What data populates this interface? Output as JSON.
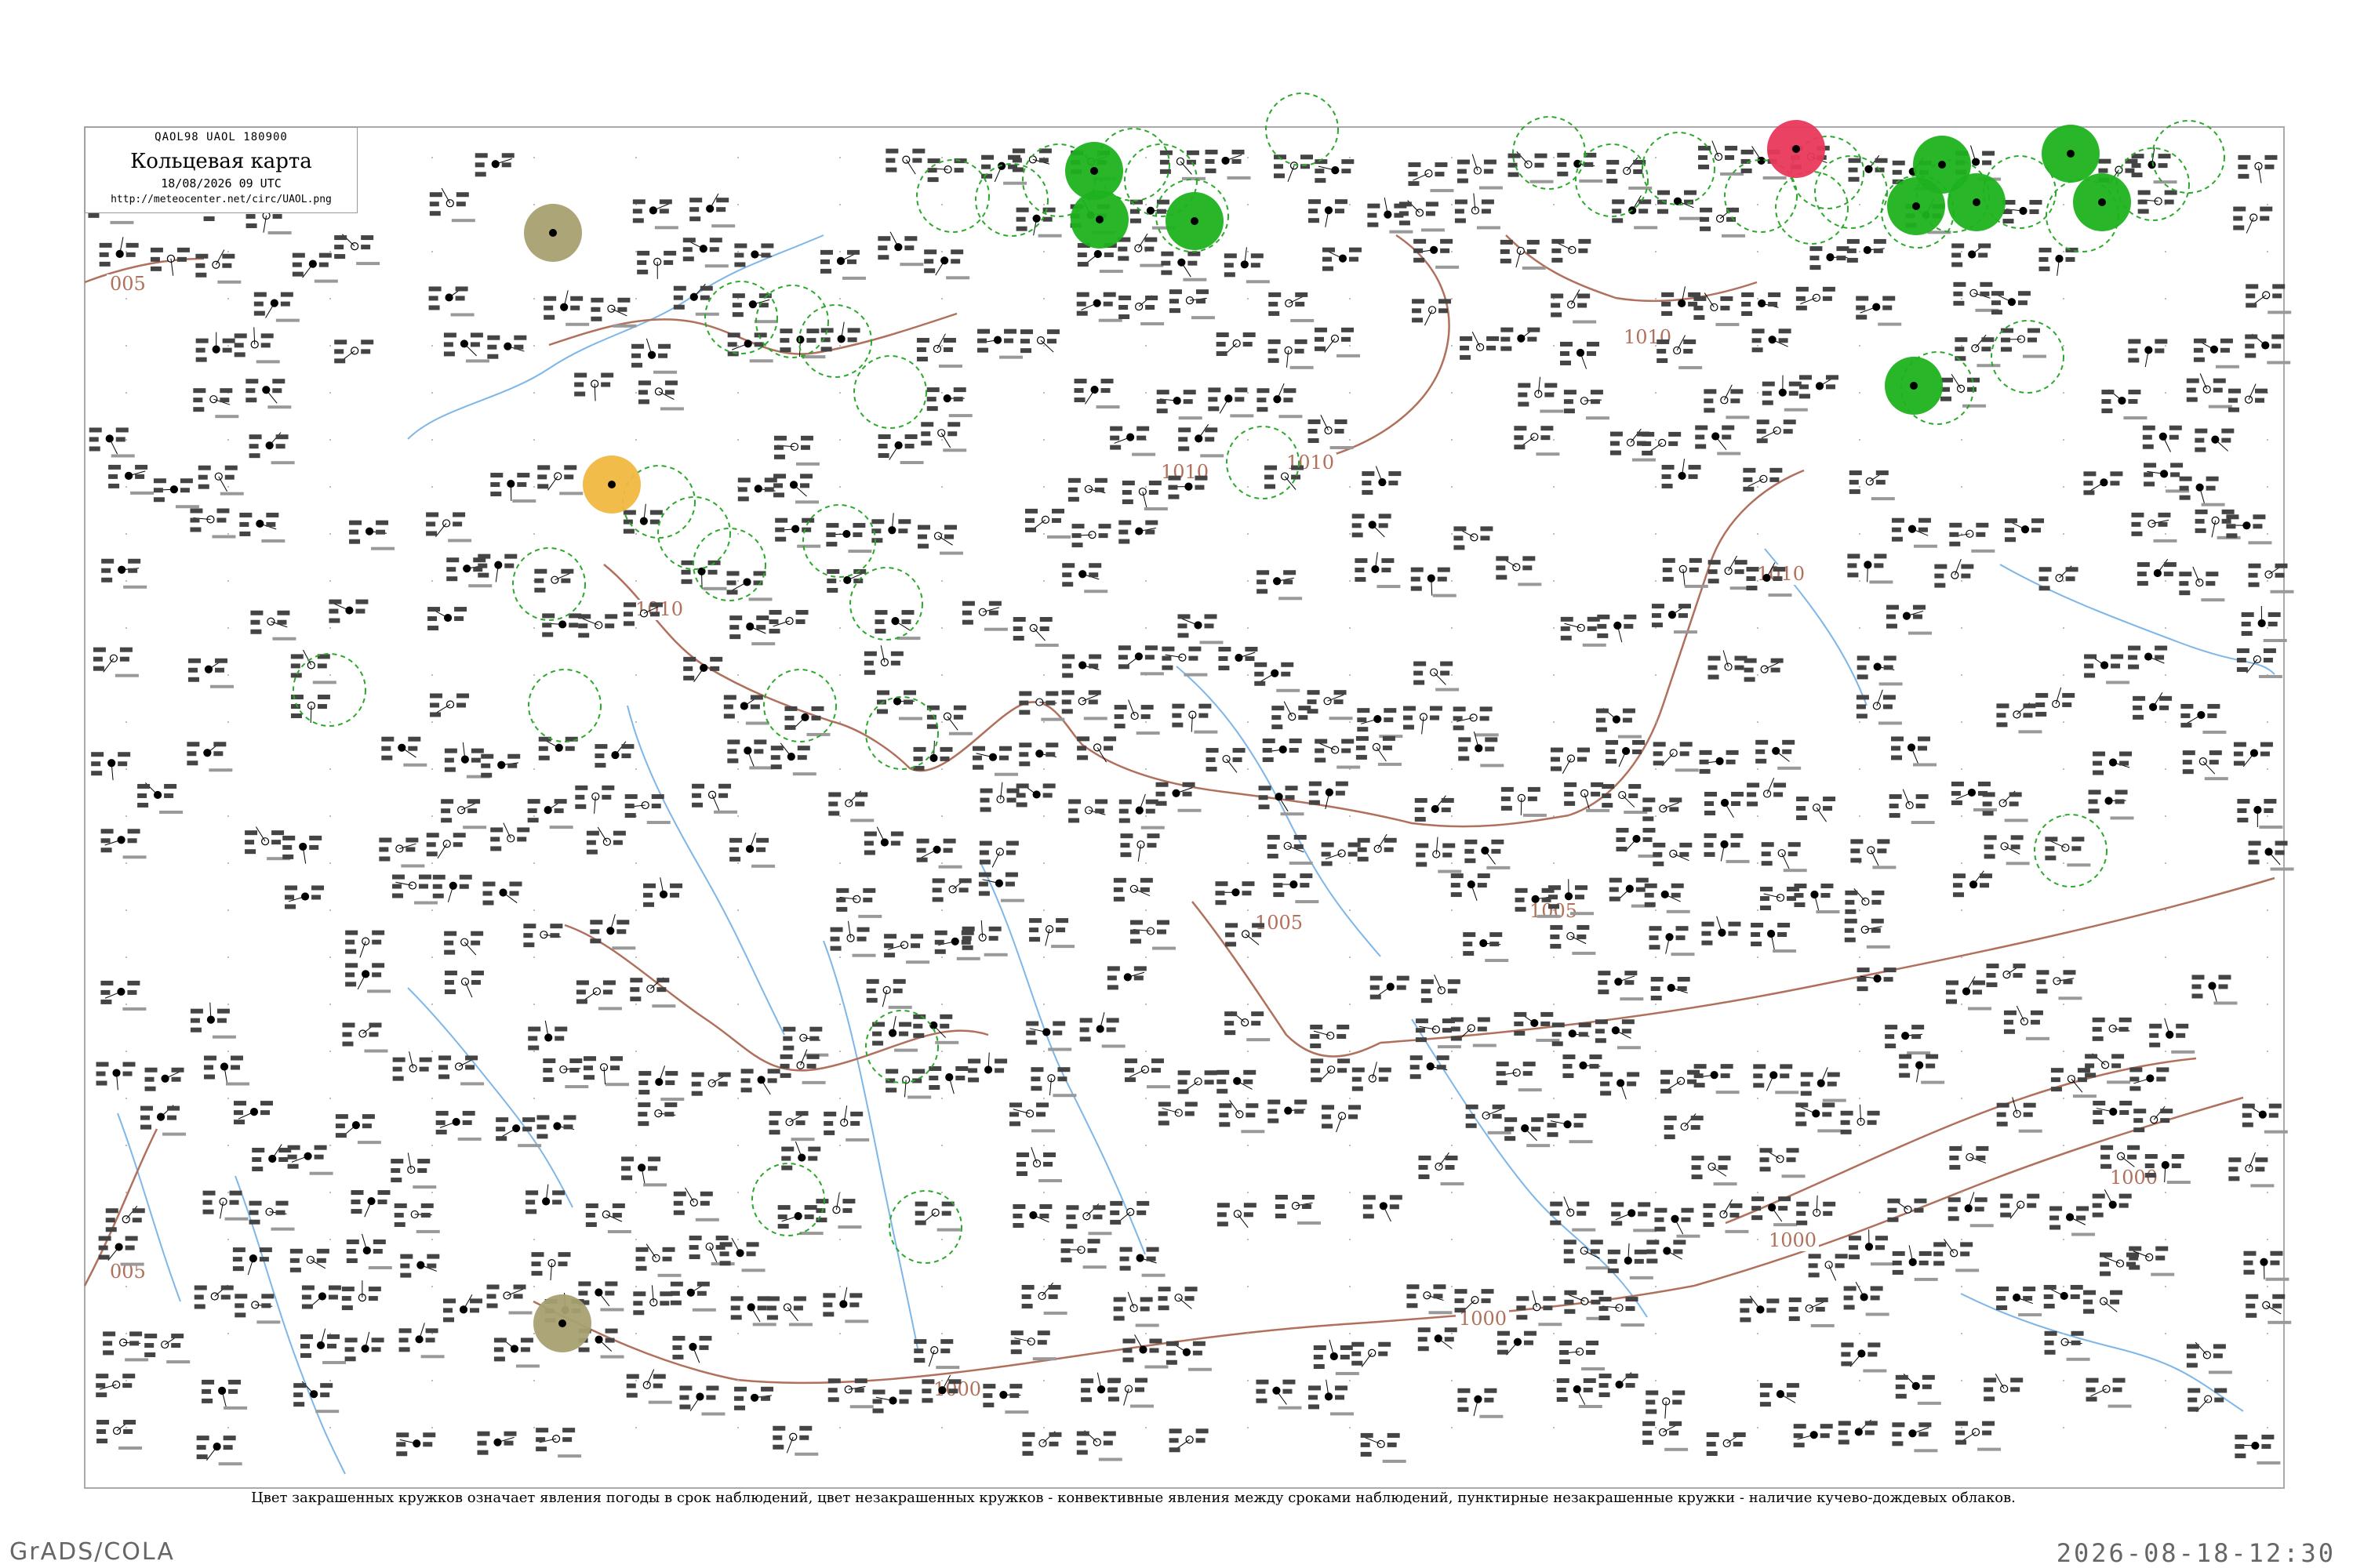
{
  "header": {
    "code_line": "QAOL98  UAOL  180900",
    "title": "Кольцевая карта",
    "datetime": "18/08/2026 09 UTC",
    "url": "http://meteocenter.net/circ/UAOL.png"
  },
  "caption": "Цвет закрашенных кружков означает явления погоды в срок наблюдений, цвет незакрашенных кружков - конвективные явления между сроками наблюдений, пунктирные незакрашенные кружки - наличие кучево-дождевых облаков.",
  "footer": {
    "left": "GrADS/COLA",
    "right": "2026-08-18-12:30"
  },
  "isobar_labels": [
    "1010",
    "1010",
    "1010",
    "1010",
    "1010",
    "1005",
    "1005",
    "1000",
    "1000",
    "1000",
    "1000",
    "005",
    "005"
  ],
  "colors": {
    "isobar": "#b0705c",
    "river": "#7eb6e8",
    "cb_dashed": "#2aa82a",
    "filled_green": "#1db21d",
    "filled_orange": "#f0b840",
    "filled_olive": "#a8a070",
    "filled_red": "#e8385a",
    "frame": "#aaaaaa"
  }
}
